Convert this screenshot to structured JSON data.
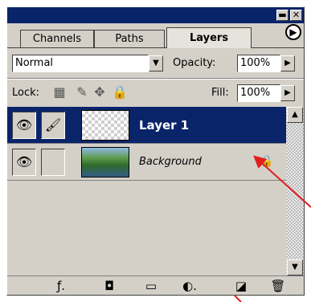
{
  "tabs": [
    {
      "label": "Channels"
    },
    {
      "label": "Paths"
    },
    {
      "label": "Layers"
    }
  ],
  "blend_mode": {
    "value": "Normal"
  },
  "opacity": {
    "label": "Opacity:",
    "value": "100%"
  },
  "lock": {
    "label": "Lock:"
  },
  "fill": {
    "label": "Fill:",
    "value": "100%"
  },
  "layers": [
    {
      "name": "Layer 1",
      "selected": true
    },
    {
      "name": "Background",
      "selected": false
    }
  ],
  "icons": {
    "palette_menu": "circle-arrow-icon",
    "eye": "eye-icon",
    "brush": "brush-icon",
    "lock": "padlock-icon",
    "bottom": [
      "layer-style-icon",
      "layer-mask-icon",
      "layer-set-icon",
      "adjustment-layer-icon",
      "new-layer-icon",
      "trash-icon"
    ]
  },
  "colors": {
    "title_bar": "#0a246a",
    "selected_layer": "#0a246a",
    "annotation_arrow": "#e02020"
  }
}
